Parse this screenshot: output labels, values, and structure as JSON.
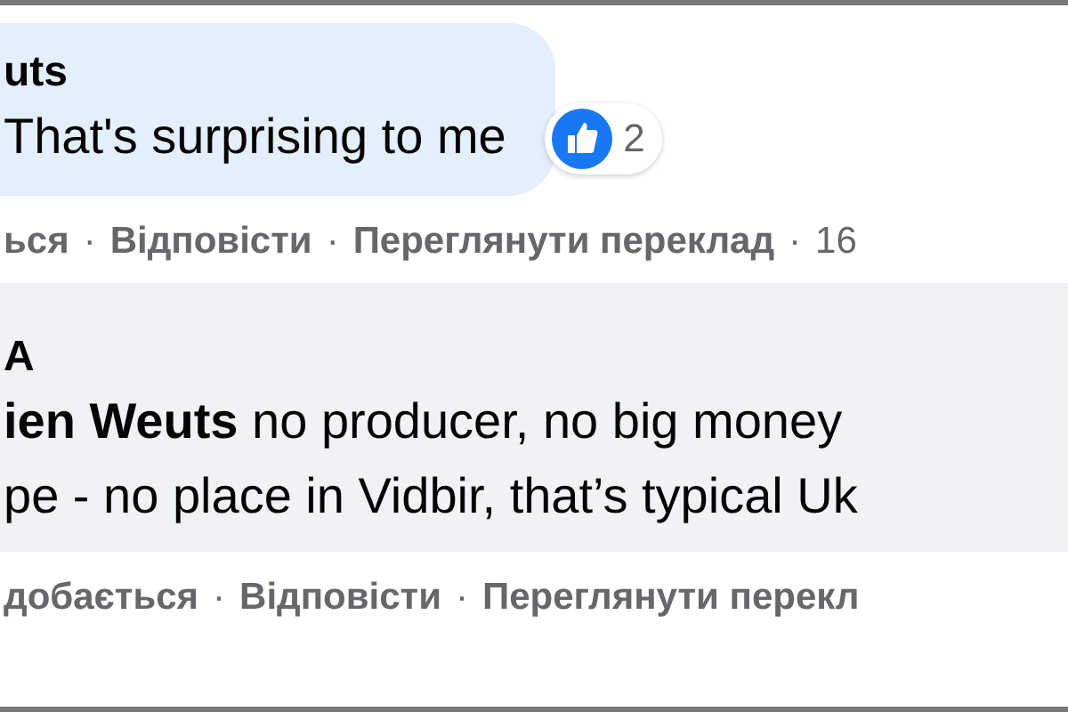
{
  "comments": [
    {
      "author": "uts",
      "text": "That's surprising to me",
      "reaction": {
        "count": "2"
      },
      "highlighted": false,
      "actions": [
        "ься",
        "Відповісти",
        "Переглянути переклад",
        "16"
      ]
    },
    {
      "author": "A",
      "lines": [
        "**ien Weuts** no producer, no big money",
        "pe - no place in Vidbir, that’s typical Uk"
      ],
      "highlighted": true,
      "actions": [
        "добається",
        "Відповісти",
        "Переглянути перекл"
      ]
    }
  ],
  "separator": "·"
}
